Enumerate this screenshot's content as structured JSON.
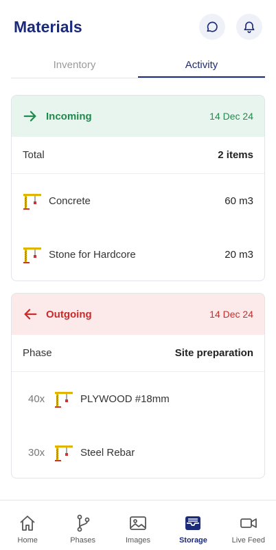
{
  "header": {
    "title": "Materials"
  },
  "tabs": [
    {
      "label": "Inventory",
      "active": false
    },
    {
      "label": "Activity",
      "active": true
    }
  ],
  "incoming": {
    "label": "Incoming",
    "date": "14 Dec 24",
    "summary_label": "Total",
    "summary_value": "2 items",
    "items": [
      {
        "name": "Concrete",
        "amount": "60 m3"
      },
      {
        "name": "Stone for Hardcore",
        "amount": "20 m3"
      }
    ]
  },
  "outgoing": {
    "label": "Outgoing",
    "date": "14 Dec 24",
    "summary_label": "Phase",
    "summary_value": "Site preparation",
    "items": [
      {
        "qty": "40x",
        "name": "PLYWOOD #18mm"
      },
      {
        "qty": "30x",
        "name": "Steel Rebar"
      }
    ]
  },
  "nav": [
    {
      "label": "Home",
      "icon": "home-icon",
      "active": false
    },
    {
      "label": "Phases",
      "icon": "branch-icon",
      "active": false
    },
    {
      "label": "Images",
      "icon": "image-icon",
      "active": false
    },
    {
      "label": "Storage",
      "icon": "storage-icon",
      "active": true
    },
    {
      "label": "Live Feed",
      "icon": "video-icon",
      "active": false
    }
  ],
  "colors": {
    "primary": "#1c2a7a",
    "incoming": "#1f8a4c",
    "incoming_bg": "#e7f5ee",
    "outgoing": "#c92a2a",
    "outgoing_bg": "#fce9e9"
  }
}
